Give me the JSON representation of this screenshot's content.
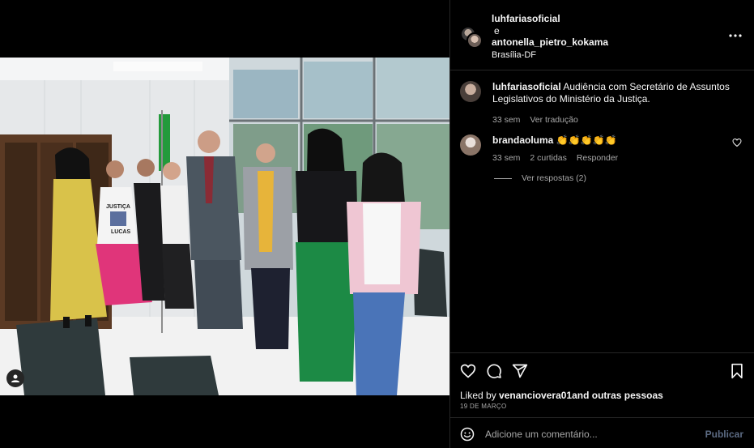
{
  "post": {
    "author": "luhfariasoficial",
    "conjunction": "e",
    "coauthor": "antonella_pietro_kokama",
    "location": "Brasília-DF"
  },
  "caption": {
    "username": "luhfariasoficial",
    "text": "Audiência com Secretário de Assuntos Legislativos do Ministério da Justiça.",
    "time": "33 sem",
    "translate": "Ver tradução"
  },
  "comments": [
    {
      "username": "brandaoluma",
      "text": "👏👏👏👏👏",
      "time": "33 sem",
      "likes": "2 curtidas",
      "reply": "Responder",
      "view_replies": "Ver respostas (2)"
    }
  ],
  "likes": {
    "prefix": "Liked by ",
    "user": "venanciovera01",
    "and": "and ",
    "others": "outras pessoas"
  },
  "date": "19 DE MARÇO",
  "comment_box": {
    "placeholder": "Adicione um comentário...",
    "publish": "Publicar"
  },
  "photo_text": {
    "shirt_line1": "JUSTIÇA",
    "shirt_line2": "LUCAS"
  },
  "colors": {
    "background": "#000000",
    "text": "#f5f5f5",
    "muted": "#a8a8a8",
    "border": "#262626",
    "publish_disabled": "#5c6b83"
  },
  "icons": {
    "more": "more-icon",
    "heart": "heart-icon",
    "comment": "comment-icon",
    "share": "share-icon",
    "save": "bookmark-icon",
    "emoji": "emoji-icon",
    "tagged_user": "user-icon"
  }
}
